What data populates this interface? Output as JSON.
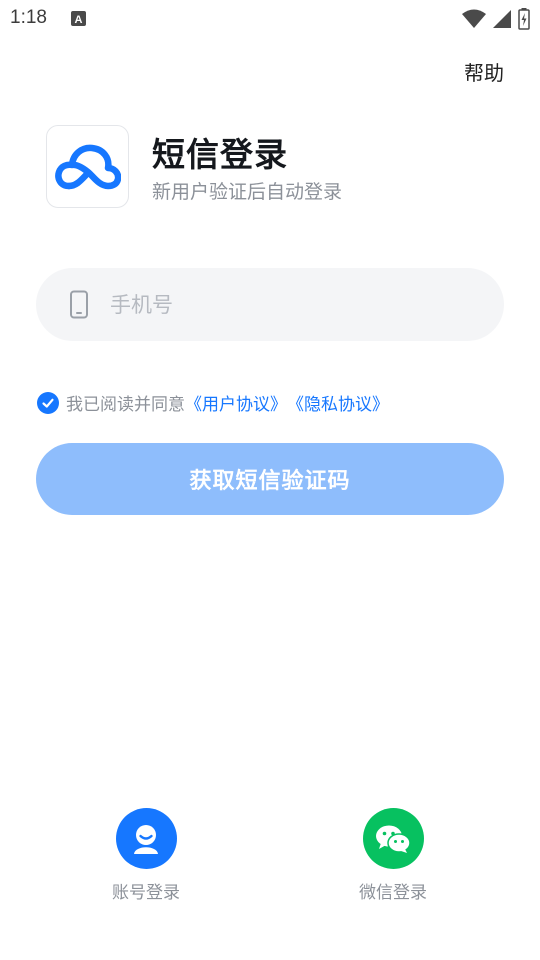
{
  "status_bar": {
    "time": "1:18",
    "notification_icon": "font-a-icon",
    "icons": [
      "wifi-icon",
      "signal-icon",
      "battery-icon"
    ]
  },
  "header": {
    "help_label": "帮助",
    "title": "短信登录",
    "subtitle": "新用户验证后自动登录",
    "logo_icon": "cloud-icon"
  },
  "phone": {
    "value": "",
    "placeholder": "手机号",
    "icon": "phone-icon"
  },
  "agreement": {
    "checked": true,
    "prefix": "我已阅读并同意",
    "user_agreement": "《用户协议》",
    "privacy_policy": "《隐私协议》"
  },
  "submit_label": "获取短信验证码",
  "alt_logins": [
    {
      "label": "账号登录",
      "icon": "account-icon",
      "color": "#1677ff"
    },
    {
      "label": "微信登录",
      "icon": "wechat-icon",
      "color": "#07c160"
    }
  ],
  "colors": {
    "accent": "#1677ff",
    "button_disabled": "#8ebdfc",
    "wechat": "#07c160"
  }
}
